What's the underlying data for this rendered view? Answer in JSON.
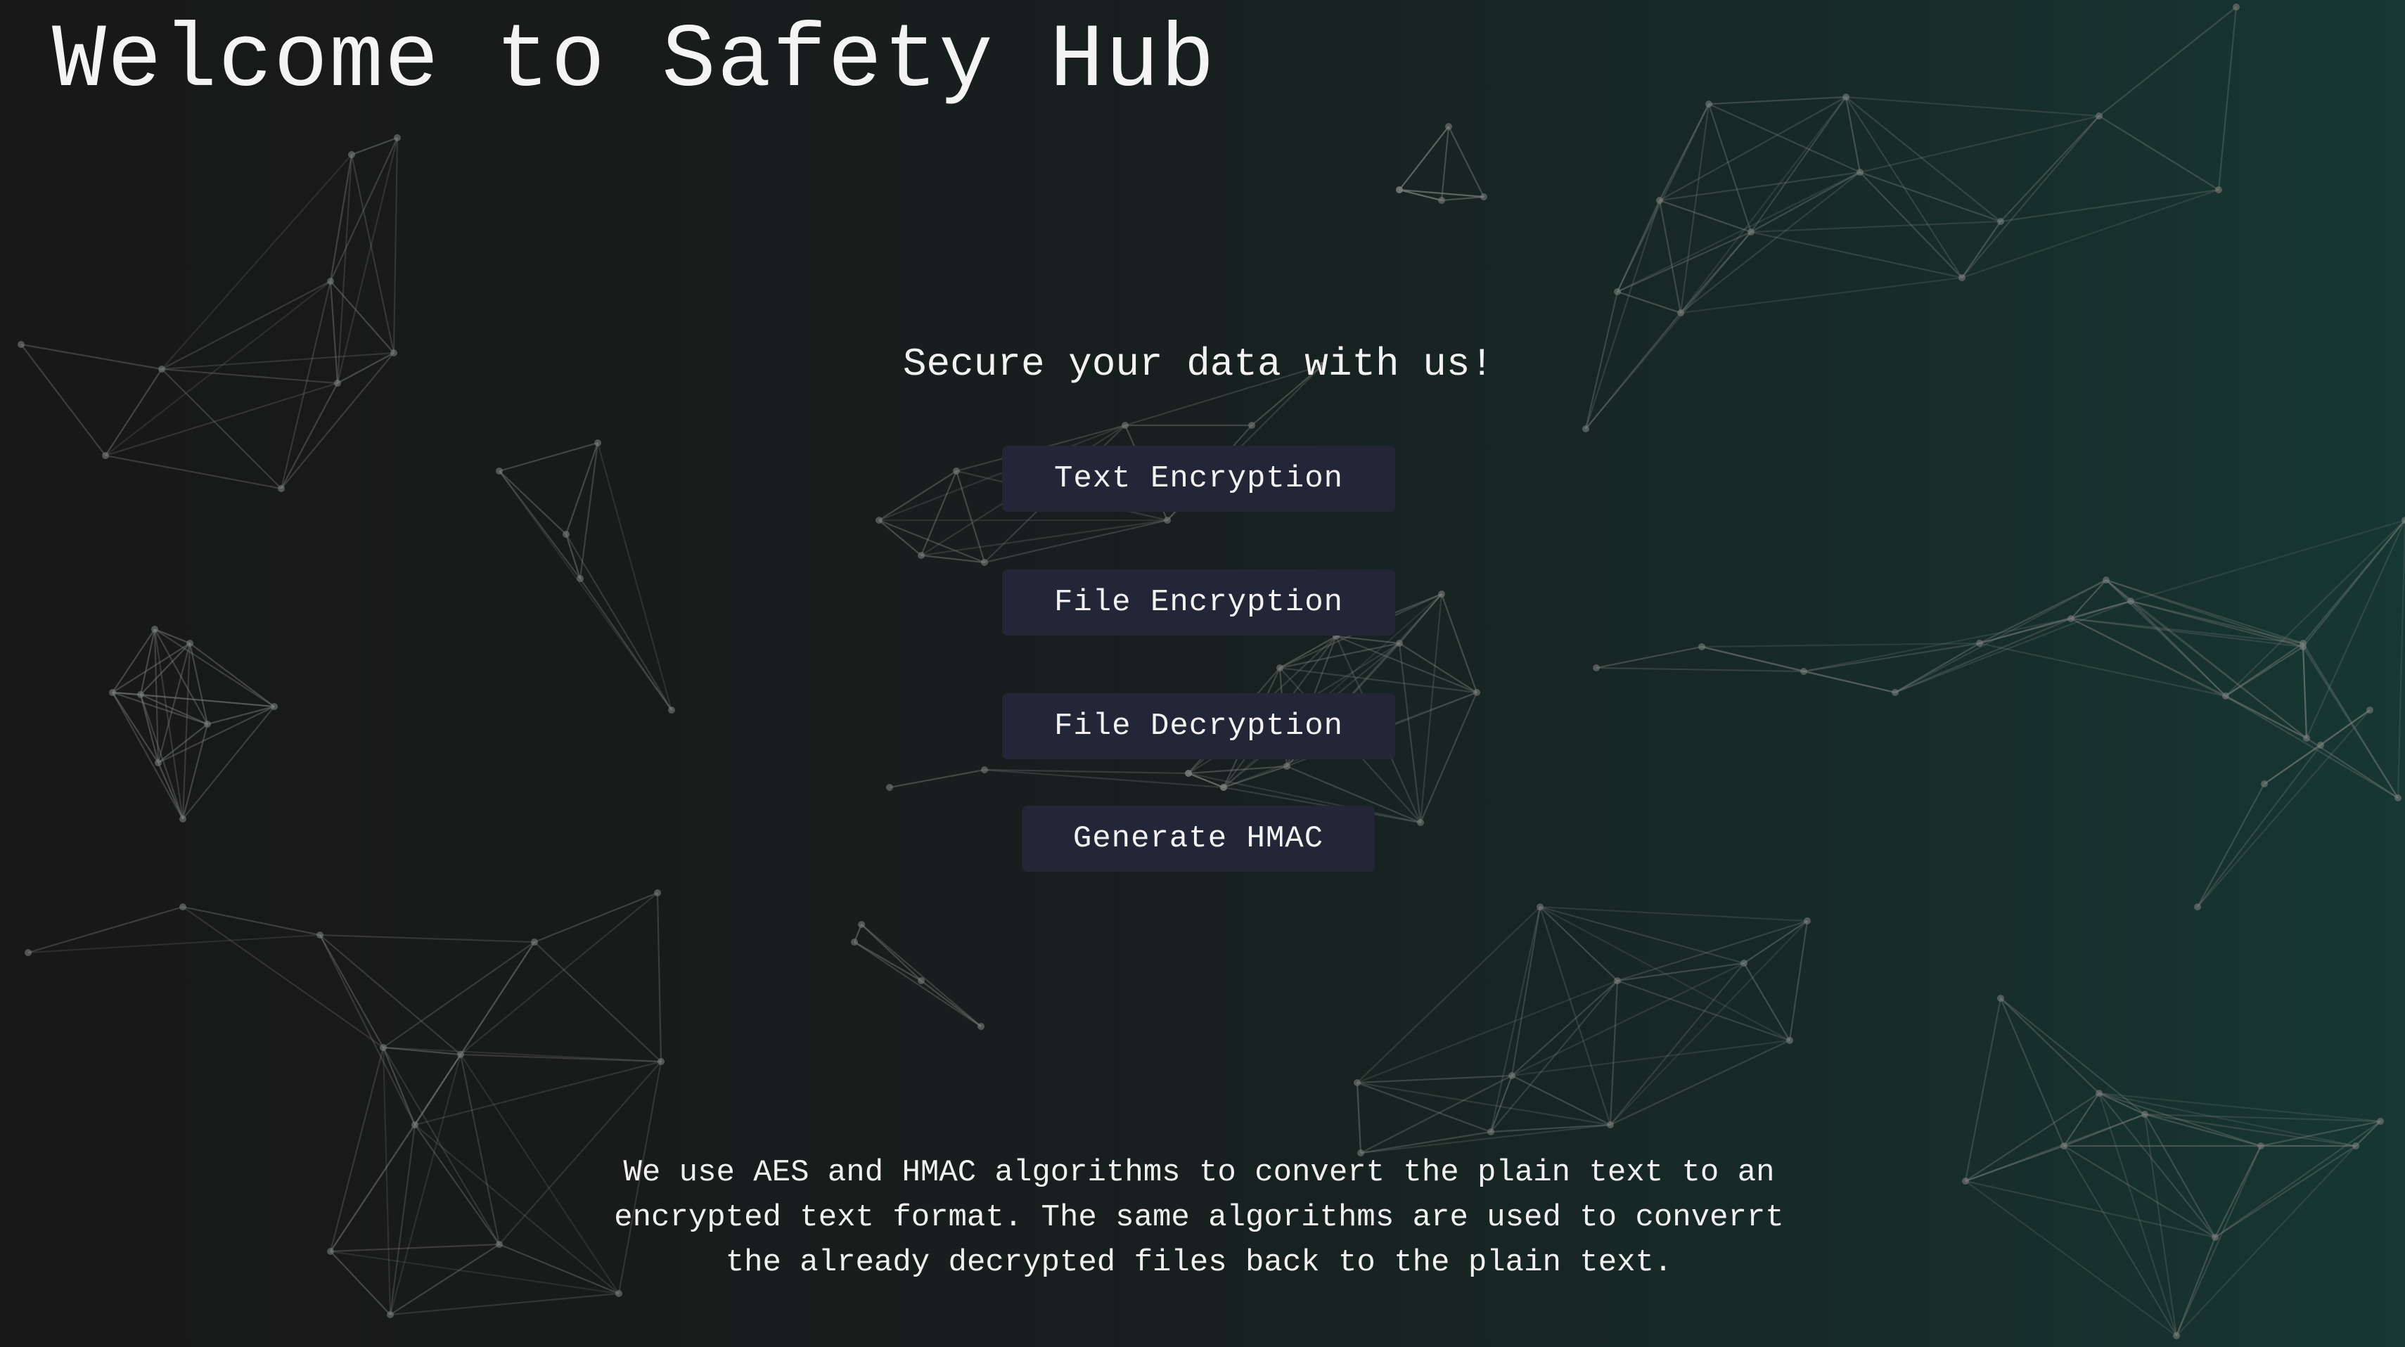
{
  "page": {
    "title": "Welcome to Safety Hub",
    "tagline": "Secure your data with us!",
    "description": "We use AES and HMAC algorithms to convert the plain text to an encrypted text format. The same algorithms are used to converrt the already decrypted files back to the plain text."
  },
  "actions": {
    "text_encryption": "Text Encryption",
    "file_encryption": "File Encryption",
    "file_decryption": "File Decryption",
    "generate_hmac": "Generate HMAC"
  },
  "colors": {
    "background_left": "#181818",
    "background_right": "#173733",
    "button_background": "#222637",
    "text": "#f2f2f2",
    "network_lines": "#7a7f7c"
  }
}
